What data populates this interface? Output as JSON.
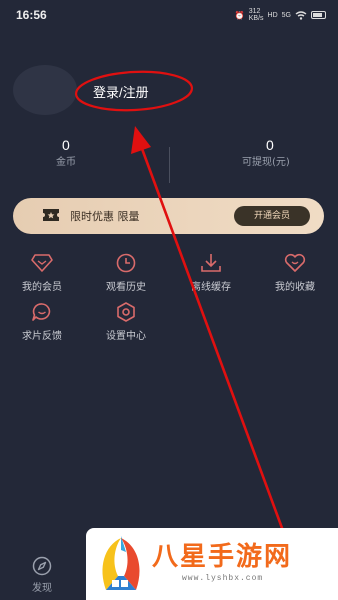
{
  "status_bar": {
    "time": "16:56",
    "net1": "312",
    "net1_unit": "KB/s",
    "hd": "HD",
    "signal": "5G",
    "battery_icon": "battery-icon",
    "wifi_icon": "wifi-icon"
  },
  "profile": {
    "login_label": "登录/注册"
  },
  "stats": {
    "coins": {
      "value": "0",
      "label": "金币"
    },
    "withdrawable": {
      "value": "0",
      "label": "可提现(元)"
    }
  },
  "vip": {
    "text": "限时优惠 限量",
    "button": "开通会员",
    "gradient_colors": [
      "#e6cdb2",
      "#f0dcc5"
    ]
  },
  "menu": [
    {
      "label": "我的会员",
      "icon": "diamond-icon"
    },
    {
      "label": "观看历史",
      "icon": "clock-icon"
    },
    {
      "label": "离线缓存",
      "icon": "download-icon"
    },
    {
      "label": "我的收藏",
      "icon": "heart-icon"
    },
    {
      "label": "求片反馈",
      "icon": "feedback-icon"
    },
    {
      "label": "设置中心",
      "icon": "settings-icon"
    }
  ],
  "bottom_nav": {
    "discover_label": "发现"
  },
  "watermark": {
    "text": "八星手游网",
    "url": "www.lyshbx.com"
  },
  "colors": {
    "background": "#232838",
    "icon_accent": "#d96b6b",
    "annotation_red": "#e01010"
  }
}
